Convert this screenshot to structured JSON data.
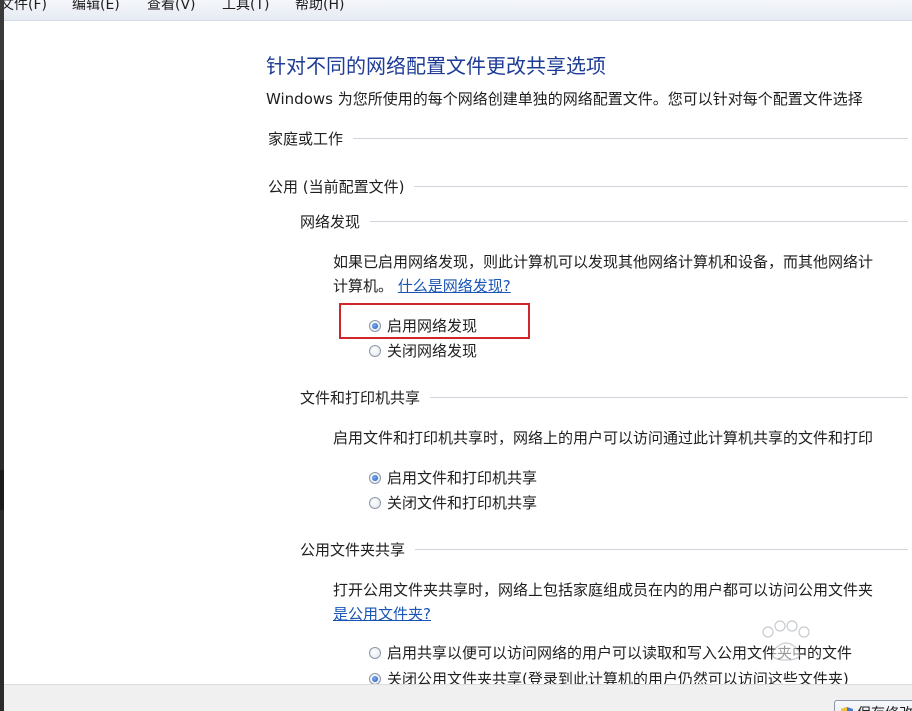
{
  "menu": {
    "items": [
      "文件(F)",
      "编辑(E)",
      "查看(V)",
      "工具(T)",
      "帮助(H)"
    ]
  },
  "page": {
    "title": "针对不同的网络配置文件更改共享选项",
    "description": "Windows 为您所使用的每个网络创建单独的网络配置文件。您可以针对每个配置文件选择"
  },
  "profiles": {
    "home_work": "家庭或工作",
    "public": "公用 (当前配置文件)"
  },
  "network_discovery": {
    "header": "网络发现",
    "desc_line1": "如果已启用网络发现，则此计算机可以发现其他网络计算机和设备，而其他网络计",
    "desc_line2": "计算机。",
    "link": "什么是网络发现?",
    "options": [
      "启用网络发现",
      "关闭网络发现"
    ]
  },
  "file_printer": {
    "header": "文件和打印机共享",
    "desc": "启用文件和打印机共享时，网络上的用户可以访问通过此计算机共享的文件和打印",
    "options": [
      "启用文件和打印机共享",
      "关闭文件和打印机共享"
    ]
  },
  "public_folder": {
    "header": "公用文件夹共享",
    "desc": "打开公用文件夹共享时，网络上包括家庭组成员在内的用户都可以访问公用文件夹",
    "link": "是公用文件夹?",
    "options": [
      "启用共享以便可以访问网络的用户可以读取和写入公用文件夹中的文件",
      "关闭公用文件夹共享(登录到此计算机的用户仍然可以访问这些文件夹)"
    ]
  },
  "footer": {
    "save_label": "保存修改"
  },
  "colors": {
    "title": "#1e3c96",
    "link": "#1a55b5",
    "highlight": "#d0262a"
  }
}
